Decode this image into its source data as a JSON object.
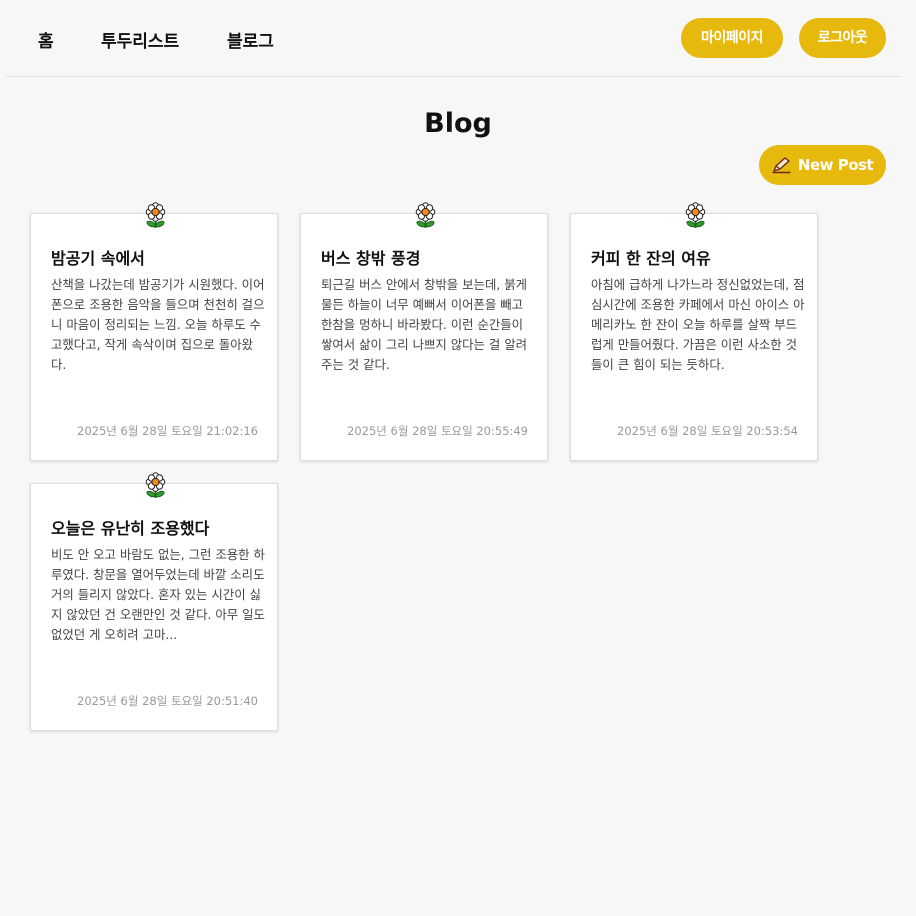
{
  "nav": {
    "home": "홈",
    "todo": "투두리스트",
    "blog": "블로그",
    "mypage": "마이페이지",
    "logout": "로그아웃"
  },
  "page": {
    "title": "Blog",
    "new_post": "New Post"
  },
  "colors": {
    "accent": "#e8b90d",
    "background": "#f7f7f7"
  },
  "posts": [
    {
      "title": "밤공기 속에서",
      "body": "산책을 나갔는데 밤공기가 시원했다. 이어폰으로 조용한 음악을 들으며 천천히 걸으니 마음이 정리되는 느낌. 오늘 하루도 수고했다고, 작게 속삭이며 집으로 돌아왔다.",
      "date": "2025년 6월 28일 토요일 21:02:16",
      "icon": "flower-icon"
    },
    {
      "title": "버스 창밖 풍경",
      "body": "퇴근길 버스 안에서 창밖을 보는데, 붉게 물든 하늘이 너무 예뻐서 이어폰을 빼고 한참을 멍하니 바라봤다. 이런 순간들이 쌓여서 삶이 그리 나쁘지 않다는 걸 알려주는 것 같다.",
      "date": "2025년 6월 28일 토요일 20:55:49",
      "icon": "flower-icon"
    },
    {
      "title": "커피 한 잔의 여유",
      "body": "아침에 급하게 나가느라 정신없었는데, 점심시간에 조용한 카페에서 마신 아이스 아메리카노 한 잔이 오늘 하루를 살짝 부드럽게 만들어줬다. 가끔은 이런 사소한 것들이 큰 힘이 되는 듯하다.",
      "date": "2025년 6월 28일 토요일 20:53:54",
      "icon": "flower-icon"
    },
    {
      "title": "오늘은 유난히 조용했다",
      "body": "비도 안 오고 바람도 없는, 그런 조용한 하루였다. 창문을 열어두었는데 바깥 소리도 거의 들리지 않았다. 혼자 있는 시간이 싫지 않았던 건 오랜만인 것 같다. 아무 일도 없었던 게 오히려 고마...",
      "date": "2025년 6월 28일 토요일 20:51:40",
      "icon": "flower-icon"
    }
  ]
}
